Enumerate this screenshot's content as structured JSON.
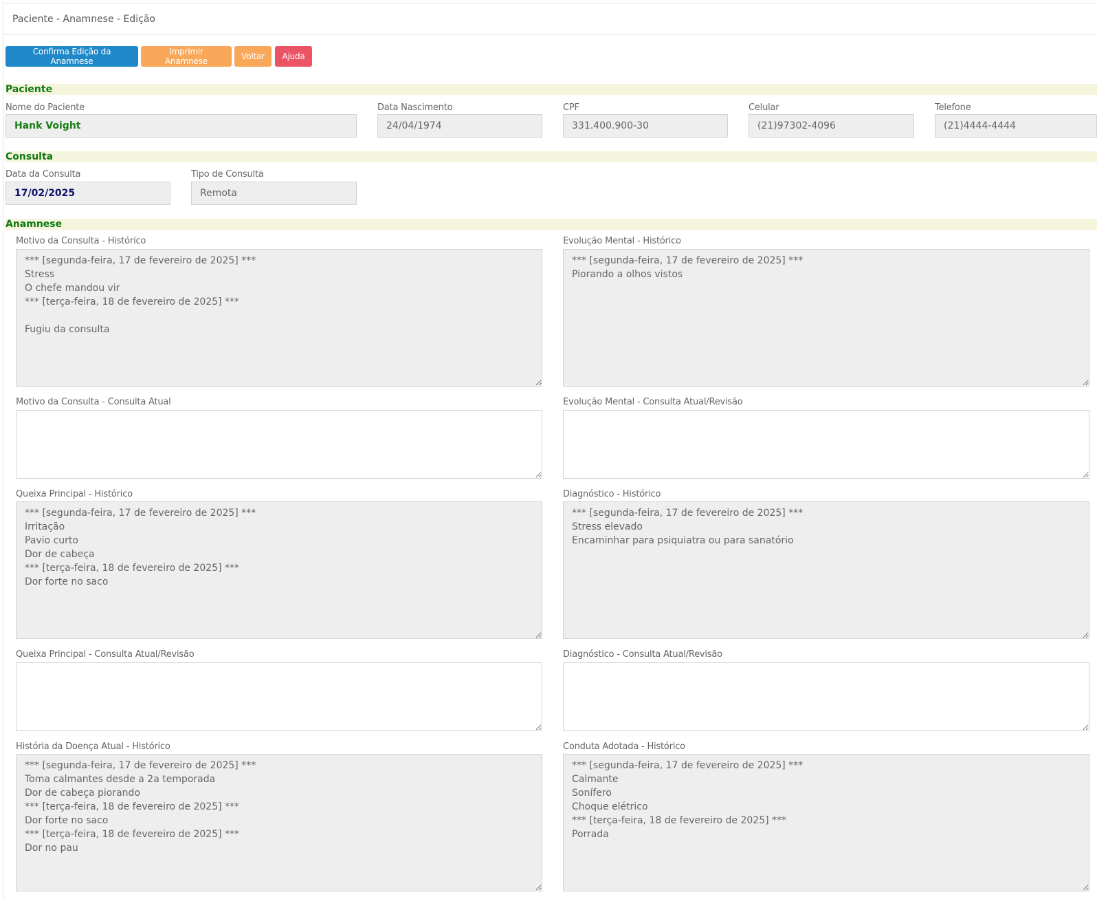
{
  "header": {
    "title": "Paciente - Anamnese - Edição"
  },
  "toolbar": {
    "confirm_label": "Confirma Edição da Anamnese",
    "print_label": "Imprimir Anamnese",
    "back_label": "Voltar",
    "help_label": "Ajuda"
  },
  "colors": {
    "primary": "#1f88c9",
    "warning": "#f9a85a",
    "danger": "#ea5465",
    "section_title": "#107a10",
    "section_bg": "#f5f5dd"
  },
  "paciente": {
    "section_title": "Paciente",
    "nome_label": "Nome do Paciente",
    "nome_value": "Hank Voight",
    "nascimento_label": "Data Nascimento",
    "nascimento_value": "24/04/1974",
    "cpf_label": "CPF",
    "cpf_value": "331.400.900-30",
    "celular_label": "Celular",
    "celular_value": "(21)97302-4096",
    "telefone_label": "Telefone",
    "telefone_value": "(21)4444-4444"
  },
  "consulta": {
    "section_title": "Consulta",
    "data_label": "Data da Consulta",
    "data_value": "17/02/2025",
    "tipo_label": "Tipo de Consulta",
    "tipo_value": "Remota"
  },
  "anamnese": {
    "section_title": "Anamnese",
    "motivo_hist_label": "Motivo da Consulta - Histórico",
    "motivo_hist_value": "*** [segunda-feira, 17 de fevereiro de 2025] ***\nStress\nO chefe mandou vir\n*** [terça-feira, 18 de fevereiro de 2025] ***\n\nFugiu da consulta",
    "evolucao_hist_label": "Evolução Mental - Histórico",
    "evolucao_hist_value": "*** [segunda-feira, 17 de fevereiro de 2025] ***\nPiorando a olhos vistos",
    "motivo_atual_label": "Motivo da Consulta - Consulta Atual",
    "motivo_atual_value": "",
    "evolucao_atual_label": "Evolução Mental - Consulta Atual/Revisão",
    "evolucao_atual_value": "",
    "queixa_hist_label": "Queixa Principal - Histórico",
    "queixa_hist_value": "*** [segunda-feira, 17 de fevereiro de 2025] ***\nIrritação\nPavio curto\nDor de cabeça\n*** [terça-feira, 18 de fevereiro de 2025] ***\nDor forte no saco",
    "diagnostico_hist_label": "Diagnóstico - Histórico",
    "diagnostico_hist_value": "*** [segunda-feira, 17 de fevereiro de 2025] ***\nStress elevado\nEncaminhar para psiquiatra ou para sanatório",
    "queixa_atual_label": "Queixa Principal - Consulta Atual/Revisão",
    "queixa_atual_value": "",
    "diagnostico_atual_label": "Diagnóstico - Consulta Atual/Revisão",
    "diagnostico_atual_value": "",
    "historia_hist_label": "História da Doença Atual - Histórico",
    "historia_hist_value": "*** [segunda-feira, 17 de fevereiro de 2025] ***\nToma calmantes desde a 2a temporada\nDor de cabeça piorando\n*** [terça-feira, 18 de fevereiro de 2025] ***\nDor forte no saco\n*** [terça-feira, 18 de fevereiro de 2025] ***\nDor no pau",
    "conduta_hist_label": "Conduta Adotada - Histórico",
    "conduta_hist_value": "*** [segunda-feira, 17 de fevereiro de 2025] ***\nCalmante\nSonífero\nChoque elétrico\n*** [terça-feira, 18 de fevereiro de 2025] ***\nPorrada"
  }
}
